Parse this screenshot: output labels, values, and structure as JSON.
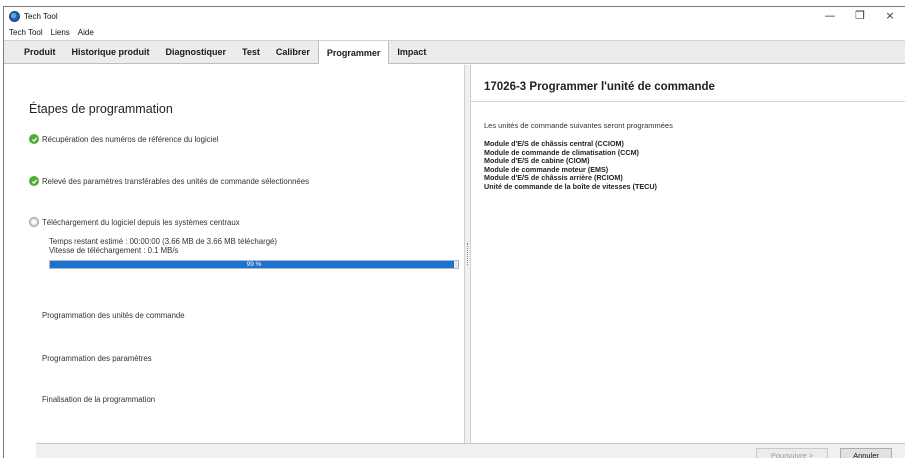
{
  "window": {
    "title": "Tech Tool",
    "controls": {
      "minimize": "—",
      "maximize": "❐",
      "close": "×"
    }
  },
  "menu": {
    "items": [
      "Tech Tool",
      "Liens",
      "Aide"
    ]
  },
  "tabs": [
    {
      "label": "Produit",
      "active": false
    },
    {
      "label": "Historique produit",
      "active": false
    },
    {
      "label": "Diagnostiquer",
      "active": false
    },
    {
      "label": "Test",
      "active": false
    },
    {
      "label": "Calibrer",
      "active": false
    },
    {
      "label": "Programmer",
      "active": true
    },
    {
      "label": "Impact",
      "active": false
    }
  ],
  "steps": {
    "title": "Étapes de programmation",
    "items": [
      {
        "label": "Récupération des numéros de référence du logiciel",
        "status": "done",
        "icon": "check-icon"
      },
      {
        "label": "Relevé des paramètres transférables des unités de commande sélectionnées",
        "status": "done",
        "icon": "check-icon"
      },
      {
        "label": "Téléchargement du logiciel depuis les systèmes centraux",
        "status": "in-progress",
        "icon": "pending-icon"
      },
      {
        "label": "Programmation des unités de commande",
        "status": "pending"
      },
      {
        "label": "Programmation des paramètres",
        "status": "pending"
      },
      {
        "label": "Finalisation de la programmation",
        "status": "pending"
      }
    ],
    "download": {
      "remaining": "Temps restant estimé : 00:00:00 (3.66 MB de 3.66 MB téléchargé)",
      "speed": "Vitesse de téléchargement : 0.1 MB/s",
      "progress_percent": 99,
      "progress_label": "99 %"
    }
  },
  "panel": {
    "title": "17026-3 Programmer l'unité de commande",
    "intro": "Les unités de commande suivantes seront programmées",
    "modules": [
      "Module d'E/S de châssis central (CCIOM)",
      "Module de commande de climatisation (CCM)",
      "Module d'E/S de cabine (CIOM)",
      "Module de commande moteur (EMS)",
      "Module d'E/S de châssis arrière (RCIOM)",
      "Unité de commande de la boîte de vitesses (TECU)"
    ]
  },
  "footer": {
    "continue_label": "Poursuivre >",
    "continue_enabled": false,
    "cancel_label": "Annuler"
  },
  "colors": {
    "progress": "#1a73d1",
    "check": "#4caf35",
    "tabbar": "#ececec"
  }
}
